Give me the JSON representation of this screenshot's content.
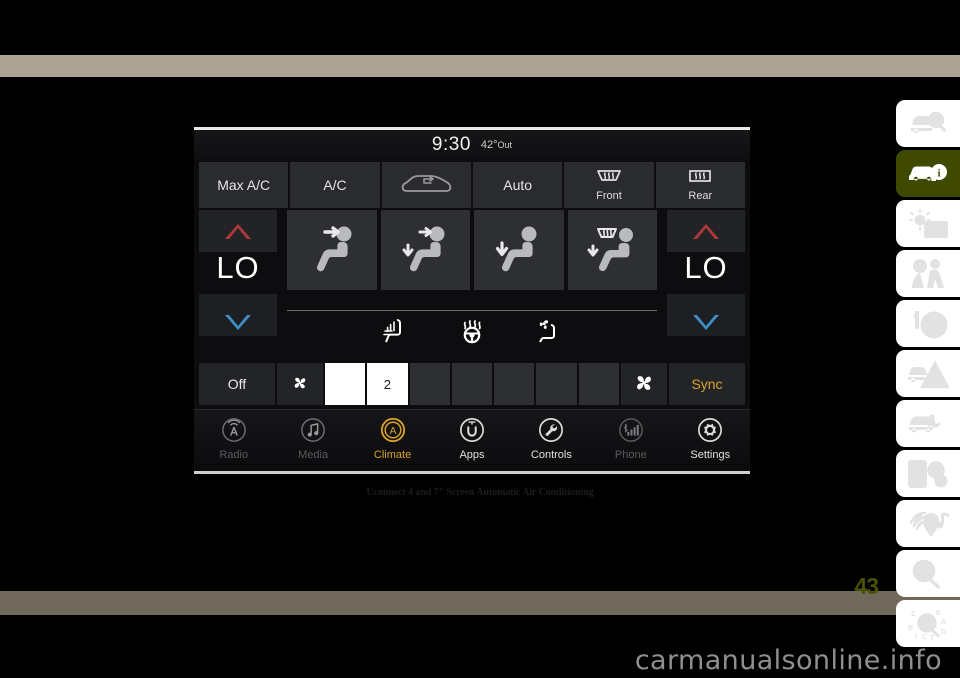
{
  "page": {
    "page_number": "43",
    "watermark": "carmanualsonline.info",
    "caption": "Uconnect 4 and 7\" Screen Automatic Air Conditioning"
  },
  "sidebar": {
    "items": [
      {
        "name": "introduction",
        "icon": "car-magnifier-icon",
        "active": false
      },
      {
        "name": "getting-to-know-your-vehicle",
        "icon": "car-info-icon",
        "active": true
      },
      {
        "name": "getting-to-know-your-instrument-panel",
        "icon": "sun-envelope-icon",
        "active": false
      },
      {
        "name": "safety",
        "icon": "airbag-occupant-icon",
        "active": false
      },
      {
        "name": "starting-and-operating",
        "icon": "key-steering-wheel-icon",
        "active": false
      },
      {
        "name": "in-case-of-emergency",
        "icon": "car-warning-triangle-icon",
        "active": false
      },
      {
        "name": "servicing-and-maintenance",
        "icon": "car-wrench-icon",
        "active": false
      },
      {
        "name": "technical-specifications",
        "icon": "list-gears-icon",
        "active": false
      },
      {
        "name": "multimedia",
        "icon": "music-signal-icon",
        "active": false
      },
      {
        "name": "index-search",
        "icon": "magnifier-icon",
        "active": false
      },
      {
        "name": "alphabetical-index",
        "icon": "abc-magnifier-icon",
        "active": false
      }
    ]
  },
  "screen": {
    "status": {
      "clock": "9:30",
      "outside_temp": "42°",
      "outside_label": "Out"
    },
    "top_buttons": [
      {
        "label": "Max A/C",
        "icon": "",
        "sub": ""
      },
      {
        "label": "A/C",
        "icon": "",
        "sub": ""
      },
      {
        "label": "",
        "icon": "recirculation-car-icon",
        "sub": ""
      },
      {
        "label": "Auto",
        "icon": "",
        "sub": ""
      },
      {
        "label": "",
        "icon": "front-defrost-icon",
        "sub": "Front"
      },
      {
        "label": "",
        "icon": "rear-defrost-icon",
        "sub": "Rear"
      }
    ],
    "temperature": {
      "left": {
        "value": "LO",
        "up": "temp-up-arrow",
        "down": "temp-down-arrow"
      },
      "right": {
        "value": "LO",
        "up": "temp-up-arrow",
        "down": "temp-down-arrow"
      }
    },
    "airflow_modes": [
      {
        "name": "face-mode",
        "icon": "seat-face-icon"
      },
      {
        "name": "bi-level-mode",
        "icon": "seat-face-floor-icon"
      },
      {
        "name": "floor-mode",
        "icon": "seat-floor-icon"
      },
      {
        "name": "defrost-floor-mode",
        "icon": "seat-defrost-floor-icon"
      }
    ],
    "comfort_icons": [
      {
        "name": "heated-seat",
        "icon": "heated-seat-icon"
      },
      {
        "name": "heated-steering-wheel",
        "icon": "heated-steering-wheel-icon"
      },
      {
        "name": "ventilated-seat",
        "icon": "ventilated-seat-icon"
      }
    ],
    "fan": {
      "off_label": "Off",
      "sync_label": "Sync",
      "decrease_icon": "fan-small-icon",
      "increase_icon": "fan-large-icon",
      "level": "2",
      "max_level": 8,
      "segments": [
        "",
        "2",
        "",
        "",
        "",
        "",
        "",
        ""
      ]
    },
    "nav": [
      {
        "label": "Radio",
        "icon": "radio-antenna-icon",
        "state": "dim"
      },
      {
        "label": "Media",
        "icon": "music-note-icon",
        "state": "dim"
      },
      {
        "label": "Climate",
        "icon": "climate-auto-icon",
        "state": "active"
      },
      {
        "label": "Apps",
        "icon": "uconnect-apps-icon",
        "state": "bright"
      },
      {
        "label": "Controls",
        "icon": "wrench-icon",
        "state": "bright"
      },
      {
        "label": "Phone",
        "icon": "phone-signal-icon",
        "state": "dim"
      },
      {
        "label": "Settings",
        "icon": "gear-icon",
        "state": "bright"
      }
    ]
  },
  "colors": {
    "accent_amber": "#d9a12a",
    "band_tan": "#aca493",
    "page_number_green": "#4a5200",
    "hot_red": "#b0373a",
    "cold_blue": "#3b8fc4",
    "tab_active_green": "#3f4a00"
  }
}
